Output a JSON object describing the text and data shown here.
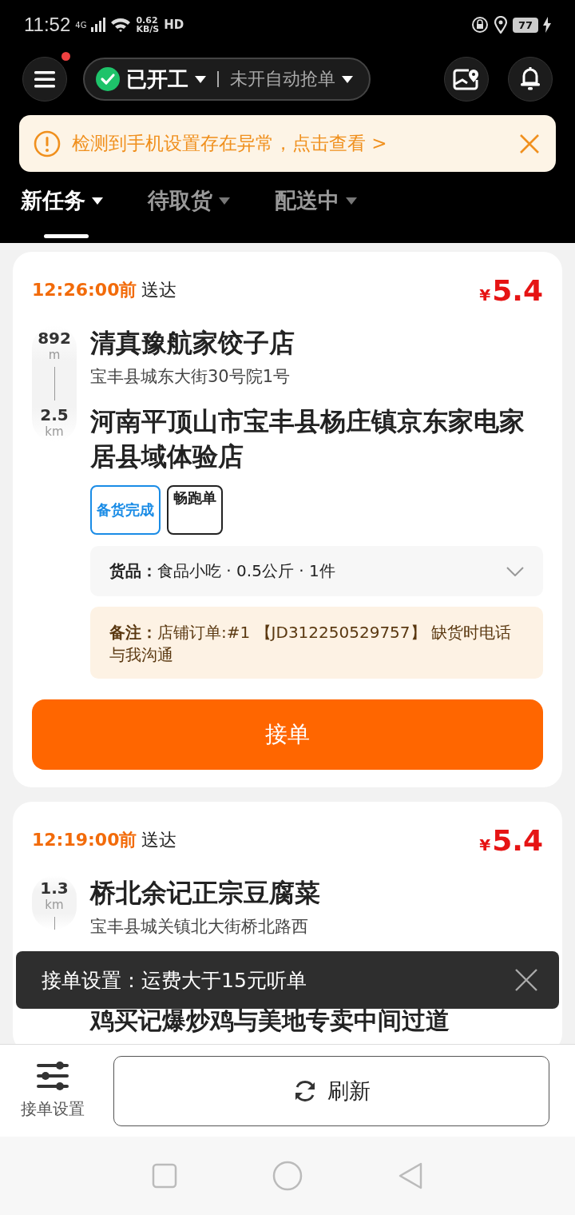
{
  "status_bar": {
    "time": "11:52",
    "network": "4G",
    "speed_value": "0.62",
    "speed_unit": "KB/S",
    "hd": "HD",
    "battery": "77"
  },
  "header": {
    "menu_badge": true,
    "work_status": {
      "label": "已开工",
      "on": true
    },
    "auto_grab": "未开自动抢单"
  },
  "notice": {
    "text": "检测到手机设置存在异常，点击查看 >"
  },
  "tabs": [
    {
      "label": "新任务",
      "selected": true
    },
    {
      "label": "待取货",
      "selected": false
    },
    {
      "label": "配送中",
      "selected": false
    }
  ],
  "orders": [
    {
      "deadline": "12:26:00前",
      "deliver": "送达",
      "currency": "¥",
      "price": "5.4",
      "distances": [
        {
          "value": "892",
          "unit": "m"
        },
        {
          "value": "2.5",
          "unit": "km"
        }
      ],
      "store": "清真豫航家饺子店",
      "store_address": "宝丰县城东大街30号院1号",
      "destination": "河南平顶山市宝丰县杨庄镇京东家电家居县域体验店",
      "destination_covered": false,
      "tags": [
        {
          "label": "备货完成",
          "kind": "status"
        },
        {
          "label": "畅跑单",
          "kind": "type"
        }
      ],
      "goods_label": "货品：",
      "goods": "食品小吃 · 0.5公斤 · 1件",
      "remark_label": "备注：",
      "remark": "店铺订单:#1 【JD312250529757】 缺货时电话与我沟通",
      "accept": "接单"
    },
    {
      "deadline": "12:19:00前",
      "deliver": "送达",
      "currency": "¥",
      "price": "5.4",
      "distances": [
        {
          "value": "1.3",
          "unit": "km"
        }
      ],
      "store": "桥北余记正宗豆腐菜",
      "store_address": "宝丰县城关镇北大街桥北路西",
      "destination": "鸡买记爆炒鸡与美地专卖中间过道",
      "destination_covered": true
    }
  ],
  "toast": {
    "text": "接单设置：运费大于15元听单"
  },
  "bottom_bar": {
    "settings": "接单设置",
    "refresh": "刷新"
  }
}
